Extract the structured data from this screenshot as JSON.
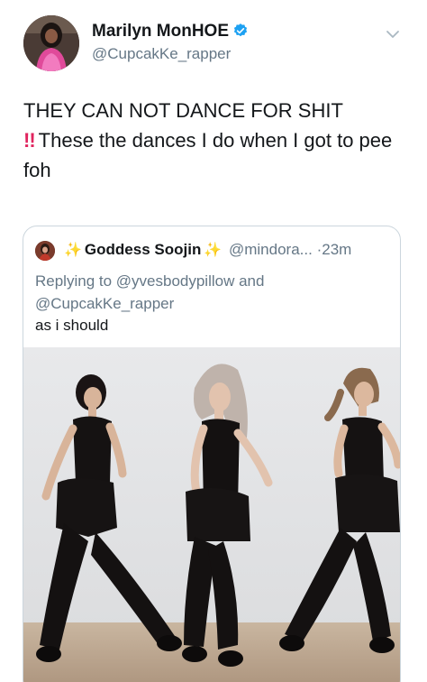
{
  "tweet": {
    "display_name": "Marilyn MonHOE",
    "handle": "@CupcakKe_rapper",
    "text_emphasis": "!!",
    "text_line1": "THEY CAN NOT DANCE FOR SHIT",
    "text_line2": "These the dances I do when I got to pee foh"
  },
  "quoted_tweet": {
    "display_name": "Goddess Soojin",
    "handle": "@mindora...",
    "separator": "·",
    "time": "23m",
    "replying_line1": "Replying to @yvesbodypillow and",
    "replying_line2": "@CupcakKe_rapper",
    "text": "as i should"
  },
  "colors": {
    "verified_badge": "#1da1f2",
    "emphasis": "#e0245e",
    "sparkle": "#f5c518"
  },
  "icons": {
    "verified": "verified-badge-icon",
    "menu": "chevron-down-icon",
    "sparkle": "sparkle-emoji"
  }
}
